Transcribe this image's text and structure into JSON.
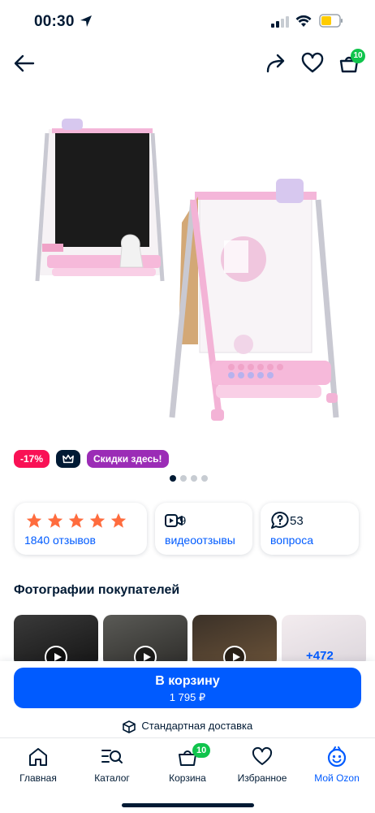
{
  "status_bar": {
    "time": "00:30"
  },
  "header": {
    "cart_badge": "10"
  },
  "badges": {
    "discount": "-17%",
    "sale": "Скидки здесь!"
  },
  "rating": {
    "reviews": "1840 отзывов",
    "stars": 5
  },
  "video": {
    "count": "9",
    "label": "видеоотзывы"
  },
  "questions": {
    "count": "53",
    "label": "вопроса"
  },
  "customer_photos": {
    "title": "Фотографии покупателей",
    "more": "+472"
  },
  "buy": {
    "label": "В корзину",
    "price": "1 795 ₽"
  },
  "delivery": {
    "label": "Стандартная доставка"
  },
  "tabbar": {
    "home": "Главная",
    "catalog": "Каталог",
    "cart": "Корзина",
    "cart_badge": "10",
    "favorites": "Избранное",
    "my_ozon": "Мой Ozon"
  },
  "colors": {
    "accent": "#005bff",
    "discount": "#f91155",
    "sale": "#9b2cb6",
    "badge_green": "#10c44c"
  }
}
